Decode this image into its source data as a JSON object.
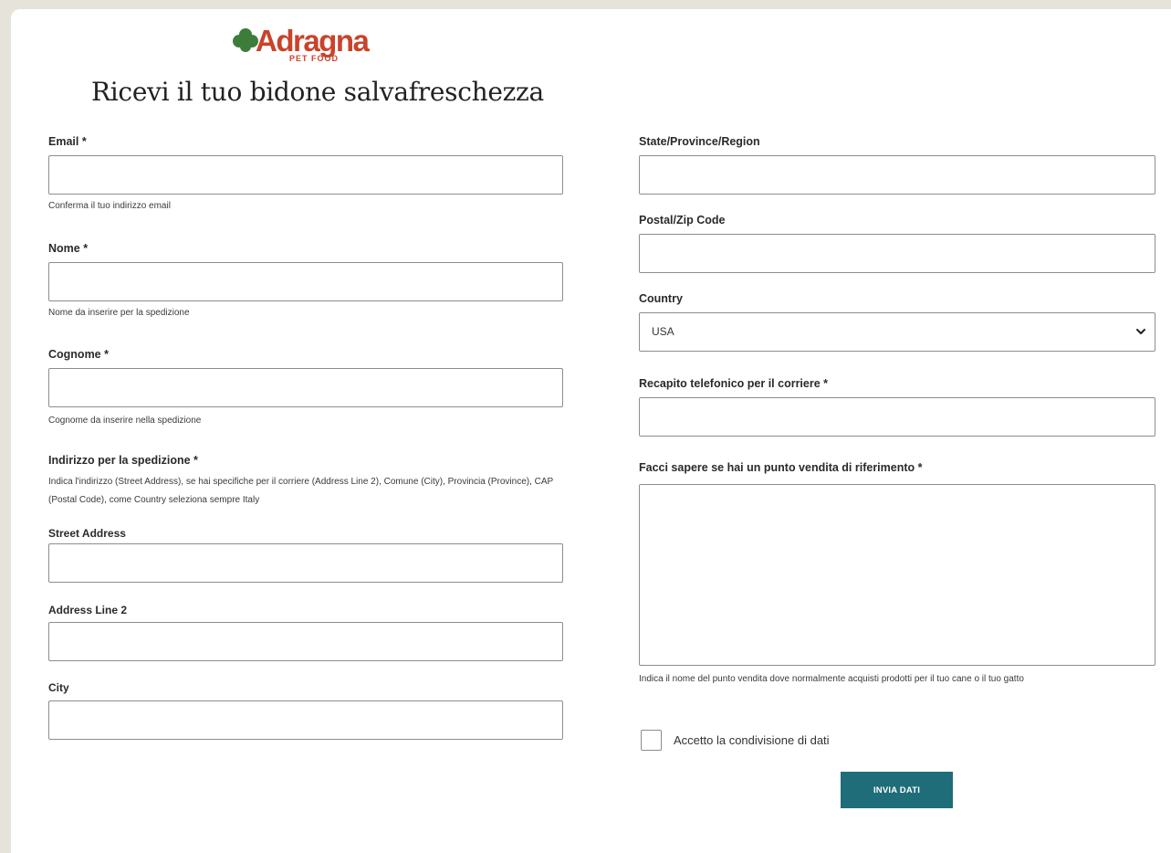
{
  "brand": {
    "name": "Adragna",
    "subtitle": "PET FOOD",
    "logo_color": "#c9432a",
    "clover_color": "#3d7d3b"
  },
  "page_title": "Ricevi il tuo bidone salvafreschezza",
  "left_column": {
    "email": {
      "label": "Email *",
      "value": "",
      "hint": "Conferma il tuo indirizzo email"
    },
    "first_name": {
      "label": "Nome *",
      "value": "",
      "hint": "Nome da inserire per la spedizione"
    },
    "last_name": {
      "label": "Cognome *",
      "value": "",
      "hint": "Cognome da inserire nella spedizione"
    },
    "address": {
      "label": "Indirizzo per la spedizione *",
      "instructions": "Indica l'indirizzo (Street Address), se hai specifiche per il corriere (Address Line 2), Comune (City), Provincia (Province), CAP (Postal Code), come Country seleziona sempre Italy",
      "street_label": "Street Address",
      "street_value": "",
      "line2_label": "Address Line 2",
      "line2_value": "",
      "city_label": "City",
      "city_value": ""
    }
  },
  "right_column": {
    "state": {
      "label": "State/Province/Region",
      "value": ""
    },
    "postal": {
      "label": "Postal/Zip Code",
      "value": ""
    },
    "country": {
      "label": "Country",
      "selected": "USA",
      "icon": "chevron-down-icon"
    },
    "phone": {
      "label": "Recapito telefonico per il corriere *",
      "value": ""
    },
    "store": {
      "label": "Facci sapere se hai un punto vendita di riferimento *",
      "value": "",
      "hint": "Indica il nome del punto vendita dove normalmente acquisti prodotti per il tuo cane o il tuo gatto"
    },
    "consent": {
      "label": "Accetto la condivisione di dati",
      "checked": false
    },
    "submit_label": "INVIA DATI",
    "submit_color": "#1f6d79"
  },
  "colors": {
    "page_background": "#e6e4da",
    "card_background": "#ffffff",
    "field_border": "#8d8d8d"
  }
}
